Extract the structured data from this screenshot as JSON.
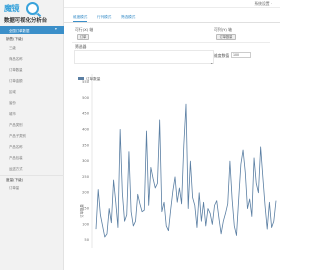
{
  "brand": {
    "logo_text": "魔镜",
    "logo_subtext": "MOJING",
    "system_title": "数据可视化分析台"
  },
  "header": {
    "user_label": "系统设置 ·"
  },
  "sidebar": {
    "active_item": "全国订单数据",
    "sections": [
      {
        "title": "销售(下级)",
        "items": [
          "三级",
          "商品名称",
          "订单数量",
          "订单金额",
          "区域",
          "省份",
          "城市",
          "产品类别",
          "产品子类别",
          "产品名称",
          "产品包装",
          "运送方式"
        ]
      },
      {
        "title": "度量(下级)",
        "items": [
          "订单量"
        ]
      }
    ]
  },
  "tabs": [
    {
      "label": "维度模式",
      "active": true
    },
    {
      "label": "行列模式",
      "active": false
    },
    {
      "label": "筛选模式",
      "active": false
    }
  ],
  "panel": {
    "left_label": "可行(X) 轴",
    "left_button": "订单",
    "right_label": "可列(Y) 轴",
    "right_button": "订单数量",
    "filter_label": "筛选器",
    "dimension_label": "维度数值",
    "dimension_value": "100",
    "collapse_caret": "⌃"
  },
  "chart_data": {
    "type": "line",
    "legend": [
      "订单数量"
    ],
    "ylabel": "订单数量",
    "ylim": [
      0,
      550
    ],
    "yticks": [
      50,
      100,
      150,
      200,
      250,
      300,
      350,
      400,
      450,
      500,
      550
    ],
    "color": "#5b7fa3",
    "values": [
      85,
      210,
      130,
      95,
      60,
      70,
      150,
      105,
      240,
      170,
      90,
      400,
      200,
      110,
      130,
      330,
      140,
      95,
      110,
      195,
      165,
      140,
      145,
      395,
      160,
      280,
      245,
      215,
      230,
      430,
      140,
      170,
      95,
      80,
      145,
      205,
      250,
      170,
      215,
      165,
      350,
      480,
      150,
      300,
      185,
      160,
      90,
      200,
      110,
      170,
      95,
      150,
      135,
      100,
      160,
      175,
      120,
      70,
      110,
      135,
      165,
      300,
      180,
      95,
      65,
      180,
      290,
      335,
      265,
      150,
      180,
      125,
      310,
      230,
      200,
      345,
      250,
      160,
      85,
      170,
      90,
      110,
      175
    ]
  }
}
